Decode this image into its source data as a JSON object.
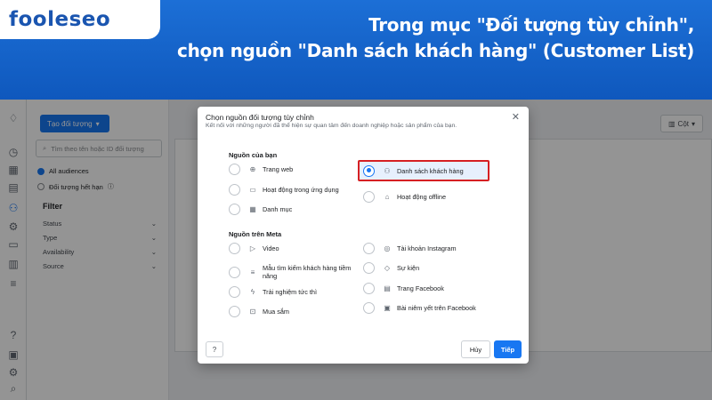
{
  "banner": {
    "logo": "fooleseo",
    "headline_line1": "Trong mục \"Đối tượng tùy chỉnh\",",
    "headline_line2": "chọn nguồn \"Danh sách khách hàng\" (Customer List)"
  },
  "app": {
    "create_button": "Tạo đối tượng",
    "search_placeholder": "Tìm theo tên hoặc ID đối tượng",
    "audiences": [
      {
        "label": "All audiences",
        "selected": true
      },
      {
        "label": "Đối tượng hết hạn",
        "selected": false
      }
    ],
    "filter_title": "Filter",
    "filters": [
      "Status",
      "Type",
      "Availability",
      "Source"
    ],
    "columns_button": "Cột"
  },
  "modal": {
    "title": "Chọn nguồn đối tượng tùy chỉnh",
    "subtitle": "Kết nối với những người đã thể hiện sự quan tâm đến doanh nghiệp hoặc sản phẩm của bạn.",
    "section_your_sources": "Nguồn của bạn",
    "your_sources": [
      {
        "label": "Trang web",
        "icon": "globe-icon",
        "glyph": "⊕"
      },
      {
        "label": "Danh sách khách hàng",
        "icon": "person-add-icon",
        "glyph": "⚇",
        "selected": true
      },
      {
        "label": "Hoạt động trong ứng dụng",
        "icon": "app-icon",
        "glyph": "▭"
      },
      {
        "label": "Hoạt động offline",
        "icon": "store-icon",
        "glyph": "⌂"
      },
      {
        "label": "Danh mục",
        "icon": "catalog-icon",
        "glyph": "▦"
      }
    ],
    "section_meta_sources": "Nguồn trên Meta",
    "meta_sources": [
      {
        "label": "Video",
        "icon": "video-icon",
        "glyph": "▷"
      },
      {
        "label": "Tài khoản Instagram",
        "icon": "instagram-icon",
        "glyph": "◎"
      },
      {
        "label": "Mẫu tìm kiếm khách hàng tiềm năng",
        "icon": "form-icon",
        "glyph": "≡"
      },
      {
        "label": "Sự kiện",
        "icon": "event-icon",
        "glyph": "◇"
      },
      {
        "label": "Trải nghiệm tức thì",
        "icon": "lightning-icon",
        "glyph": "ϟ"
      },
      {
        "label": "Trang Facebook",
        "icon": "page-icon",
        "glyph": "▤"
      },
      {
        "label": "Mua sắm",
        "icon": "cart-icon",
        "glyph": "⊡"
      },
      {
        "label": "Bài niêm yết trên Facebook",
        "icon": "listing-icon",
        "glyph": "▣"
      }
    ],
    "help_label": "?",
    "cancel_label": "Hủy",
    "next_label": "Tiếp"
  },
  "colors": {
    "banner_blue": "#1459b8",
    "accent": "#1877f2",
    "highlight_red": "#d62023"
  }
}
